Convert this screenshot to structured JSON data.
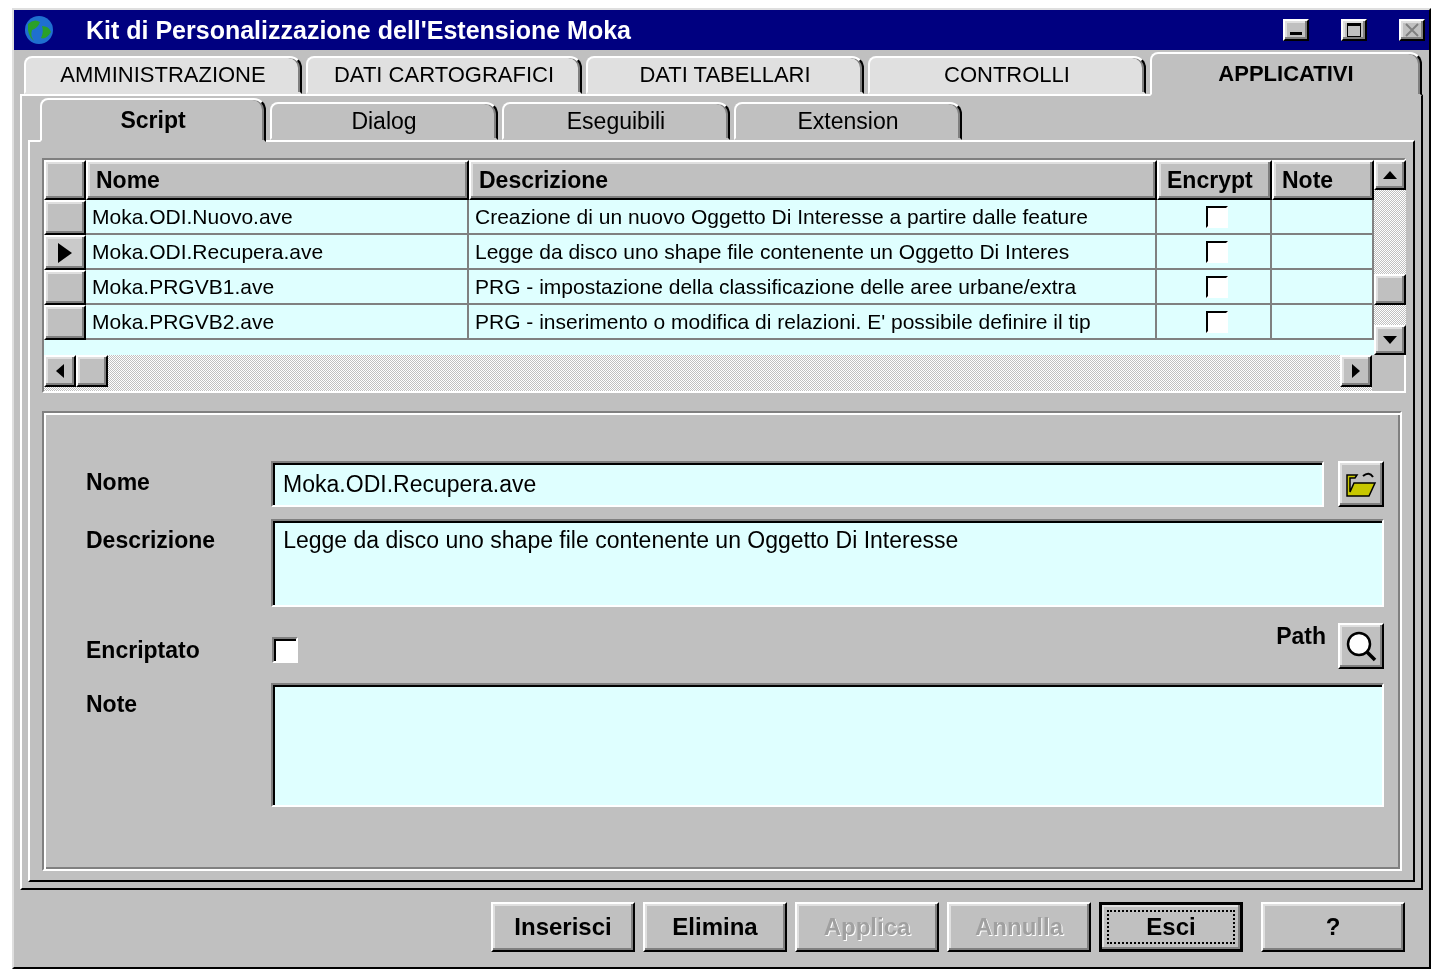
{
  "window": {
    "title": "Kit di Personalizzazione dell'Estensione Moka"
  },
  "tabs": [
    {
      "label": "AMMINISTRAZIONE",
      "selected": false
    },
    {
      "label": "DATI CARTOGRAFICI",
      "selected": false
    },
    {
      "label": "DATI TABELLARI",
      "selected": false
    },
    {
      "label": "CONTROLLI",
      "selected": false
    },
    {
      "label": "APPLICATIVI",
      "selected": true
    }
  ],
  "subtabs": [
    {
      "label": "Script",
      "selected": true
    },
    {
      "label": "Dialog",
      "selected": false
    },
    {
      "label": "Eseguibili",
      "selected": false
    },
    {
      "label": "Extension",
      "selected": false
    }
  ],
  "table": {
    "columns": [
      "Nome",
      "Descrizione",
      "Encrypt",
      "Note"
    ],
    "rows": [
      {
        "nome": "Moka.ODI.Nuovo.ave",
        "descrizione": "Creazione di un nuovo Oggetto Di Interesse a partire dalle feature",
        "encrypt": false,
        "selected": false
      },
      {
        "nome": "Moka.ODI.Recupera.ave",
        "descrizione": "Legge da disco uno shape file contenente un Oggetto Di Interes",
        "encrypt": false,
        "selected": true
      },
      {
        "nome": "Moka.PRGVB1.ave",
        "descrizione": "PRG - impostazione della classificazione delle aree urbane/extra",
        "encrypt": false,
        "selected": false
      },
      {
        "nome": "Moka.PRGVB2.ave",
        "descrizione": "PRG - inserimento o modifica di relazioni. E' possibile definire il tip",
        "encrypt": false,
        "selected": false
      }
    ]
  },
  "form": {
    "nome_label": "Nome",
    "nome_value": "Moka.ODI.Recupera.ave",
    "descrizione_label": "Descrizione",
    "descrizione_value": "Legge da disco uno shape file contenente un Oggetto Di Interesse",
    "encriptato_label": "Encriptato",
    "encriptato_checked": false,
    "path_label": "Path",
    "note_label": "Note"
  },
  "buttons": [
    {
      "label": "Inserisci",
      "disabled": false,
      "default": false
    },
    {
      "label": "Elimina",
      "disabled": false,
      "default": false
    },
    {
      "label": "Applica",
      "disabled": true,
      "default": false
    },
    {
      "label": "Annulla",
      "disabled": true,
      "default": false
    },
    {
      "label": "Esci",
      "disabled": false,
      "default": true
    },
    {
      "label": "?",
      "disabled": false,
      "default": false
    }
  ]
}
